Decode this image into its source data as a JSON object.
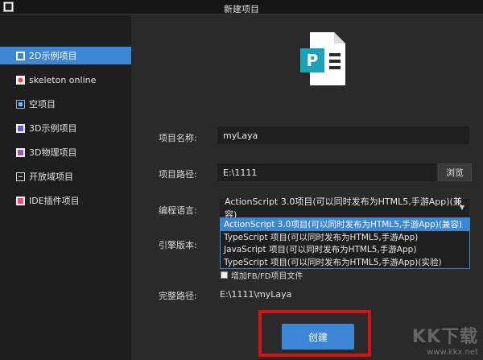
{
  "window": {
    "title": "新建项目"
  },
  "sidebar": {
    "items": [
      {
        "label": "2D示例项目",
        "icon": "laya-2d-icon",
        "active": true
      },
      {
        "label": "skeleton online",
        "icon": "skeleton-icon",
        "active": false
      },
      {
        "label": "空项目",
        "icon": "empty-project-icon",
        "active": false
      },
      {
        "label": "3D示例项目",
        "icon": "laya-3d-icon",
        "active": false
      },
      {
        "label": "3D物理项目",
        "icon": "physics-3d-icon",
        "active": false
      },
      {
        "label": "开放域项目",
        "icon": "open-domain-icon",
        "active": false
      },
      {
        "label": "IDE插件项目",
        "icon": "ide-plugin-icon",
        "active": false
      }
    ]
  },
  "form": {
    "name_label": "项目名称:",
    "name_value": "myLaya",
    "path_label": "项目路径:",
    "path_value": "E:\\1111",
    "browse_label": "浏览",
    "language_label": "编程语言:",
    "language_selected": "ActionScript 3.0项目(可以同时发布为HTML5,手游App)(兼容)",
    "language_options": [
      "ActionScript 3.0项目(可以同时发布为HTML5,手游App)(兼容)",
      "TypeScript 项目(可以同时发布为HTML5,手游App)",
      "JavaScript 项目(可以同时发布为HTML5,手游App)",
      "TypeScript 项目(可以同时发布为HTML5,手游App)(实验)"
    ],
    "engine_label": "引擎版本:",
    "fb_checkbox_label": "增加FB/FD项目文件",
    "fullpath_label": "完整路径:",
    "fullpath_value": "E:\\1111\\myLaya",
    "create_label": "创建"
  },
  "watermark": {
    "logo": "KK下载",
    "url": "www.kkx.net"
  },
  "colors": {
    "accent": "#3d86d6",
    "highlight_border": "#d41414",
    "sidebar_bg": "#1e1e1e",
    "main_bg": "#2a2a2a"
  }
}
